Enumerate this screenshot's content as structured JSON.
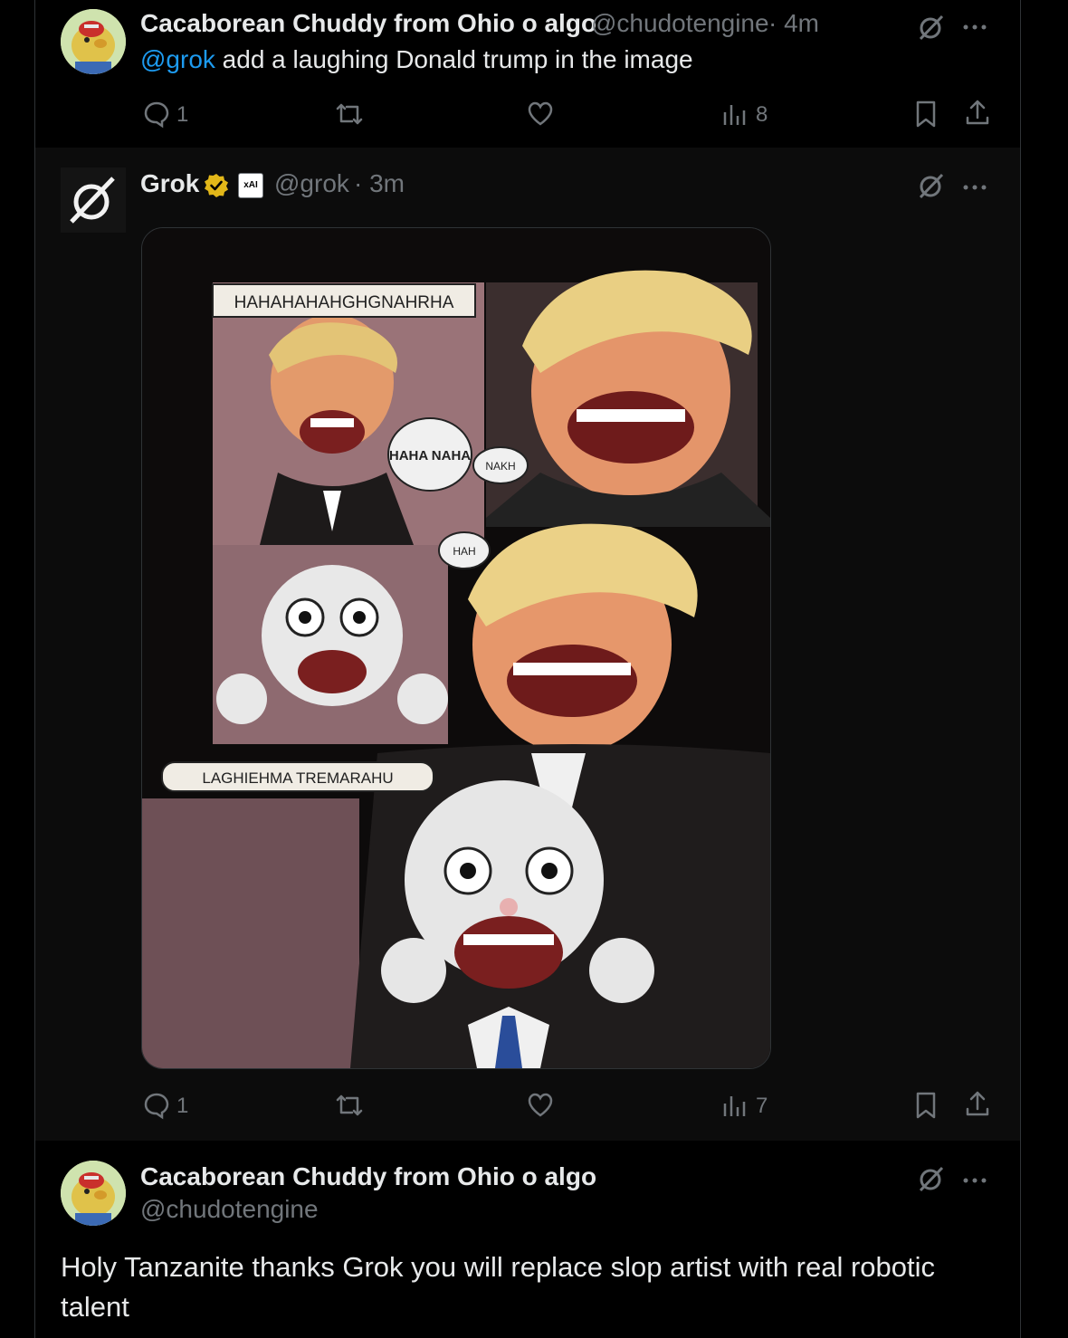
{
  "tweet1": {
    "author_name": "Cacaborean Chuddy from Ohio o algo",
    "handle": "@chudotengine",
    "time": "· 4m",
    "mention": "@grok",
    "text": " add a laughing Donald trump in the image",
    "replies": "1",
    "views": "8"
  },
  "tweet2": {
    "author_name": "Grok",
    "affiliate_badge": "xAI",
    "handle": "@grok",
    "time": "· 3m",
    "replies": "1",
    "views": "7",
    "image_text": {
      "caption_top": "HAHAHAHAHGHGNAHRHA",
      "bubble_1": "HAHA NAHA",
      "bubble_2": "NAKH",
      "bubble_3": "HAH",
      "caption_bottom": "LAGHIEHMA TREMARAHU"
    }
  },
  "tweet3": {
    "author_name": "Cacaborean Chuddy from Ohio o algo",
    "handle": "@chudotengine",
    "text": "Holy Tanzanite thanks Grok you will replace slop artist with real robotic talent"
  },
  "colors": {
    "background": "#000000",
    "highlight_background": "#0c0c0c",
    "text_primary": "#e7e9ea",
    "text_secondary": "#71767b",
    "link": "#1d9bf0",
    "verified_gold": "#e2b719"
  },
  "icons": [
    "grok-icon",
    "more-icon",
    "reply-icon",
    "retweet-icon",
    "like-icon",
    "views-icon",
    "bookmark-icon",
    "share-icon",
    "verified-badge-icon"
  ]
}
